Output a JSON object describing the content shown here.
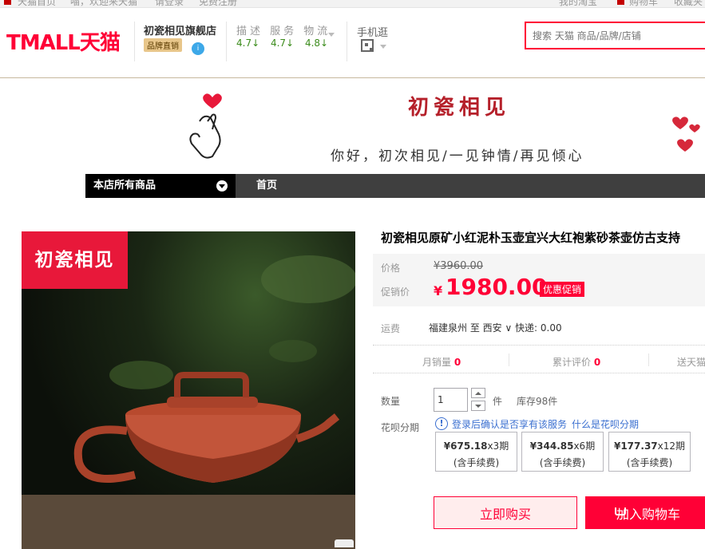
{
  "topbar": {
    "links": [
      "天猫首页",
      "喵，欢迎来天猫",
      "请登录",
      "免费注册",
      "我的淘宝",
      "购物车",
      "收藏夹"
    ]
  },
  "header": {
    "logo": "TMALL天猫",
    "shop_name": "初瓷相见旗舰店",
    "brand_badge": "品牌直销",
    "rating_labels": "描述 服务 物流",
    "ratings": [
      "4.7↓",
      "4.7↓",
      "4.8↓"
    ],
    "mobile_label": "手机逛",
    "search_placeholder": "搜索 天猫 商品/品牌/店铺"
  },
  "banner": {
    "title": "初瓷相见",
    "slogan": "你好，初次相见/一见钟情/再见倾心"
  },
  "nav": {
    "all_items": "本店所有商品",
    "home": "首页"
  },
  "product": {
    "image_brand": "初瓷相见",
    "title": "初瓷相见原矿小红泥朴玉壶宜兴大红袍紫砂茶壶仿古支持",
    "price_label": "价格",
    "original_price": "¥3960.00",
    "promo_label": "促销价",
    "currency": "¥",
    "promo_price": "1980.00",
    "promo_tag": "优惠促销",
    "shipping_label": "运费",
    "shipping_text": "福建泉州 至 西安 ∨ 快递: 0.00",
    "stats": [
      {
        "label": "月销量",
        "value": "0"
      },
      {
        "label": "累计评价",
        "value": "0"
      }
    ],
    "stat_tail": "送天猫",
    "qty_label": "数量",
    "qty_value": "1",
    "qty_unit": "件",
    "stock": "库存98件",
    "installment_label": "花呗分期",
    "installment_note": "登录后确认是否享有该服务",
    "installment_link": "什么是花呗分期",
    "plans": [
      {
        "amount": "¥675.18",
        "term": "x3期",
        "fee": "(含手续费)"
      },
      {
        "amount": "¥344.85",
        "term": "x6期",
        "fee": "(含手续费)"
      },
      {
        "amount": "¥177.37",
        "term": "x12期",
        "fee": "(含手续费)"
      }
    ],
    "buy_now": "立即购买",
    "add_to_cart": "加入购物车"
  },
  "colors": {
    "brand_red": "#ff0036",
    "nav_dark": "#3f3f3f",
    "rating_green": "#3c8c1c"
  }
}
